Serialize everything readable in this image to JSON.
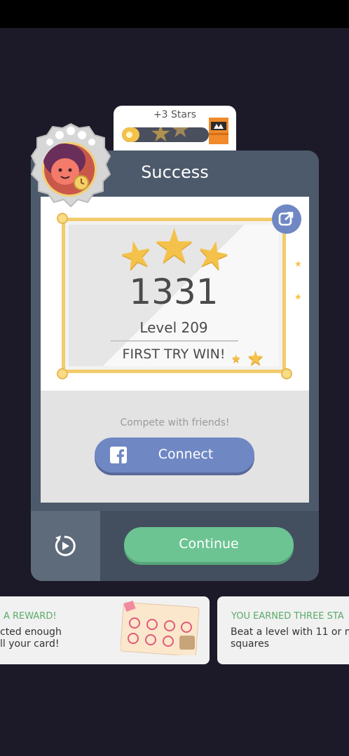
{
  "stars_progress": {
    "label": "+3 Stars",
    "fill_fraction": 0.2
  },
  "modal": {
    "title": "Success",
    "score": "1331",
    "level": "Level 209",
    "result": "FIRST TRY WIN!",
    "stars_earned": 3,
    "compete_text": "Compete with friends!",
    "connect_label": "Connect",
    "continue_label": "Continue"
  },
  "notifications": [
    {
      "heading": "A REWARD!",
      "line1": "cted enough",
      "line2": "ll your card!"
    },
    {
      "heading": "YOU EARNED THREE STA",
      "line1": "Beat a level with 11 or m",
      "line2": "squares"
    }
  ],
  "icons": {
    "share": "share-icon",
    "facebook": "facebook-icon",
    "replay": "replay-icon",
    "chest": "chest-icon",
    "avatar": "avatar-icon"
  },
  "colors": {
    "background": "#1c1a28",
    "modal": "#4d5a6b",
    "gold": "#f4c24a",
    "facebook": "#6f88c4",
    "continue": "#6cc493",
    "reward_green": "#5aaa6a"
  }
}
